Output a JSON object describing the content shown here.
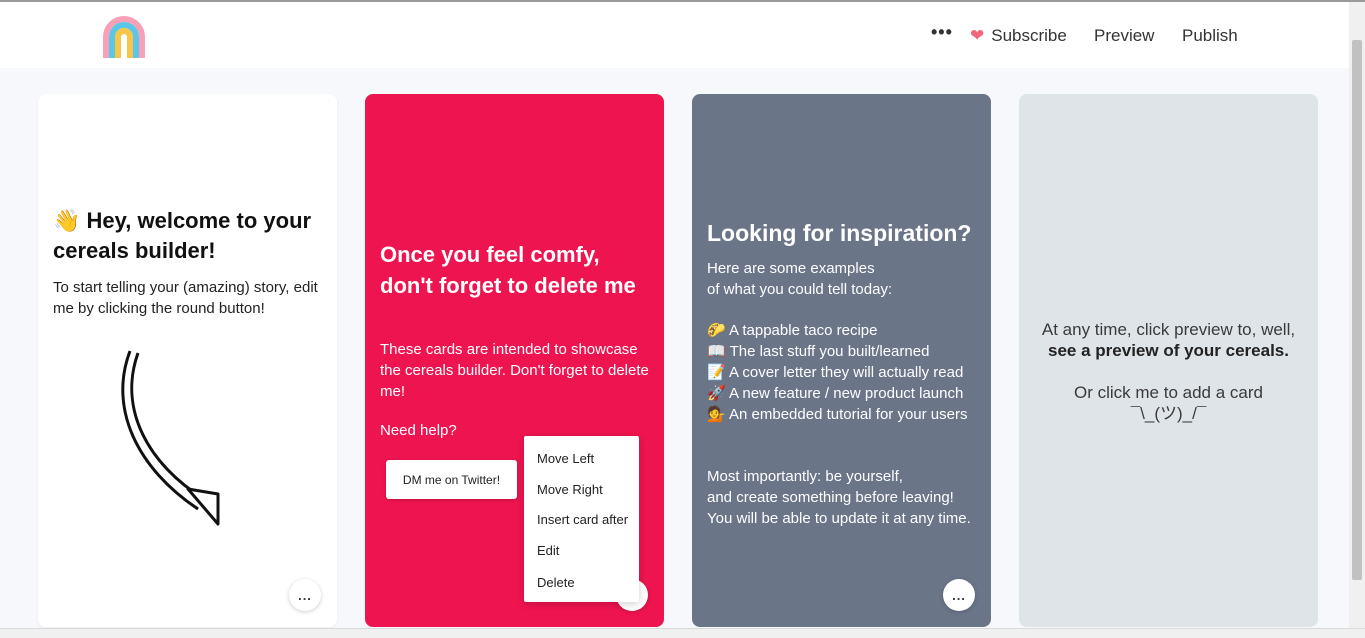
{
  "header": {
    "more_label": "•••",
    "subscribe_label": "Subscribe",
    "preview_label": "Preview",
    "publish_label": "Publish"
  },
  "colors": {
    "card_red": "#ee144f",
    "card_slate": "#6a7588",
    "card_gray": "#dfe4e8",
    "heart": "#f2657a"
  },
  "cards": [
    {
      "emoji": "👋",
      "title": "Hey, welcome to your cereals builder!",
      "text": "To start telling your (amazing) story, edit me by clicking the round button!",
      "button": "..."
    },
    {
      "title": "Once you feel comfy, don't forget to delete me",
      "text": "These cards are intended to showcase the cereals builder. Don't forget to delete me!",
      "help": "Need help?",
      "cta": "DM me on Twitter!"
    },
    {
      "title": "Looking for inspiration?",
      "intro_line1": "Here are some examples",
      "intro_line2": "of what you could tell today:",
      "items": [
        "🌮 A tappable taco recipe",
        "📖  The last stuff you built/learned",
        "📝  A cover letter they will actually read",
        "🚀  A new feature / new product launch",
        "💁  An embedded tutorial for your users"
      ],
      "outro_line1": "Most importantly: be yourself,",
      "outro_line2": "and create something before leaving!",
      "outro_line3": "You will be able to update it at any time.",
      "button": "..."
    },
    {
      "line1": "At any time, click preview to, well,",
      "line2": "see a preview of your cereals.",
      "line3": "Or click me to add a card",
      "line4": "¯\\_(ツ)_/¯"
    }
  ],
  "context_menu": {
    "items": [
      "Move Left",
      "Move Right",
      "Insert card after",
      "Edit",
      "Delete"
    ]
  }
}
